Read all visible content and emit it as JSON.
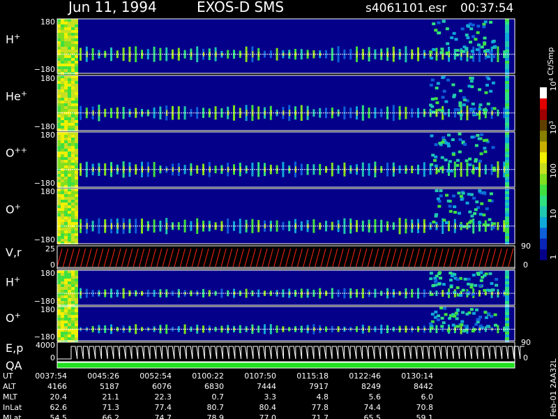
{
  "header": {
    "date": "Jun 11, 1994",
    "mission": "EXOS-D SMS",
    "file": "s4061101.esr",
    "start_time": "00:37:54"
  },
  "panels": [
    {
      "id": "h-plus-1",
      "label_main": "H",
      "label_sup": "+",
      "ytop": "180",
      "ybot": "−180"
    },
    {
      "id": "he-plus",
      "label_main": "He",
      "label_sup": "+",
      "ytop": "180",
      "ybot": "−180"
    },
    {
      "id": "o-plusplus",
      "label_main": "O",
      "label_sup": "++",
      "ytop": "180",
      "ybot": "−180"
    },
    {
      "id": "o-plus-1",
      "label_main": "O",
      "label_sup": "+",
      "ytop": "180",
      "ybot": "−180"
    },
    {
      "id": "vr",
      "label_main": "V,r",
      "label_sup": "",
      "ytop": "25",
      "ybot": "0",
      "right_top": "90",
      "right_bot": "0"
    },
    {
      "id": "h-plus-2",
      "label_main": "H",
      "label_sup": "+",
      "ytop": "180",
      "ybot": "−180"
    },
    {
      "id": "o-plus-2",
      "label_main": "O",
      "label_sup": "+",
      "ytop": "180",
      "ybot": "−180"
    },
    {
      "id": "ep",
      "label_main": "E,p",
      "label_sup": "",
      "ytop": "4000",
      "ybot": "0",
      "right_top": "90",
      "right_bot": "0"
    },
    {
      "id": "qa",
      "label_main": "QA",
      "label_sup": ""
    }
  ],
  "colorbar": {
    "unit": "Ct/Smp",
    "ticks": [
      {
        "base": "1",
        "exp": "",
        "v": 1
      },
      {
        "base": "10",
        "exp": "",
        "v": 10
      },
      {
        "base": "100",
        "exp": "",
        "v": 100
      },
      {
        "base": "10",
        "exp": "3",
        "v": 1000
      },
      {
        "base": "10",
        "exp": "4",
        "v": 10000
      }
    ],
    "colors": [
      "#04008a",
      "#0a24b8",
      "#0e60d8",
      "#10a8d8",
      "#20c8b0",
      "#30e080",
      "#40e040",
      "#80e020",
      "#c8e020",
      "#f0f000",
      "#c8b000",
      "#888000",
      "#604000",
      "#a00000",
      "#e00000",
      "#ffffff"
    ]
  },
  "footer": {
    "row_labels": [
      "UT",
      "ALT",
      "MLT",
      "InLat",
      "MLat"
    ],
    "columns": [
      [
        "0037:54",
        "4166",
        "20.4",
        "62.6",
        "54.5"
      ],
      [
        "0045:26",
        "5187",
        "21.1",
        "71.3",
        "66.2"
      ],
      [
        "0052:54",
        "6076",
        "22.3",
        "77.4",
        "74.7"
      ],
      [
        "0100:22",
        "6830",
        "0.7",
        "80.7",
        "78.9"
      ],
      [
        "0107:50",
        "7444",
        "3.3",
        "80.4",
        "77.0"
      ],
      [
        "0115:18",
        "7917",
        "4.8",
        "77.8",
        "71.7"
      ],
      [
        "0122:46",
        "8249",
        "5.6",
        "74.4",
        "65.5"
      ],
      [
        "0130:14",
        "8442",
        "6.0",
        "70.8",
        "59.1"
      ]
    ],
    "version": "Feb-01 2AA32L"
  },
  "chart_data": {
    "type": "heatmap",
    "title": "Jun 11, 1994   EXOS-D SMS",
    "x": [
      "0037:54",
      "0045:26",
      "0052:54",
      "0100:22",
      "0107:50",
      "0115:18",
      "0122:46",
      "0130:14"
    ],
    "pitch_angle_range": [
      -180,
      180
    ],
    "vr_range": [
      0,
      25
    ],
    "ep_range": [
      0,
      4000
    ],
    "colorbar_range_ct_per_smp": [
      1,
      10000
    ],
    "colorbar_scale": "log",
    "colors": {
      "background": "#04008a",
      "vr_curve": "#e02010",
      "qa_bar": "#20e020",
      "trace": "#ffffff"
    }
  }
}
